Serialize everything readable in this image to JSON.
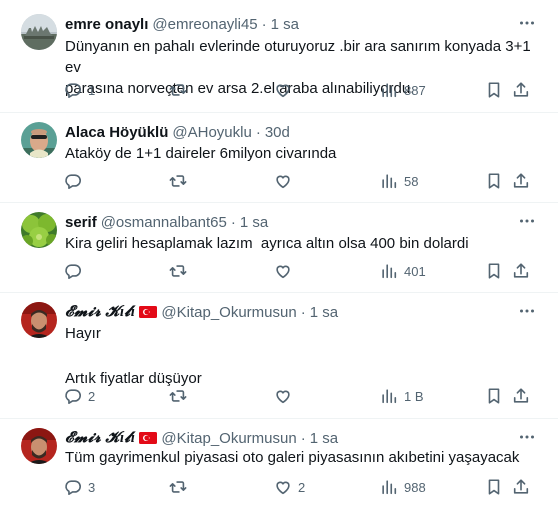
{
  "tweets": [
    {
      "name": "emre onaylı",
      "handle": "@emreonayli45",
      "time": "1 sa",
      "lines": [
        "Dünyanın en pahalı evlerinde oturuyoruz .bir ara sanırım konyada 3+1 ev",
        "parasına norveçten ev arsa 2.el araba alınabiliyordu."
      ],
      "replies": "1",
      "retweets": "",
      "likes": "",
      "views": "887"
    },
    {
      "name": "Alaca Höyüklü",
      "handle": "@AHoyuklu",
      "time": "30d",
      "lines": [
        "Ataköy de 1+1 daireler 6milyon civarında"
      ],
      "replies": "",
      "retweets": "",
      "likes": "",
      "views": "58"
    },
    {
      "name": "serif",
      "handle": "@osmannalbant65",
      "time": "1 sa",
      "lines": [
        "Kira geliri hesaplamak lazım  ayrıca altın olsa 400 bin dolardi"
      ],
      "replies": "",
      "retweets": "",
      "likes": "",
      "views": "401"
    },
    {
      "name": "𝓔𝓶𝓲𝓻 𝓚ı𝓵ı",
      "handle": "@Kitap_Okurmusun",
      "time": "1 sa",
      "lines": [
        "Hayır",
        "",
        "Artık fiyatlar düşüyor"
      ],
      "replies": "2",
      "retweets": "",
      "likes": "",
      "views": "1 B"
    },
    {
      "name": "𝓔𝓶𝓲𝓻 𝓚ı𝓵ı",
      "handle": "@Kitap_Okurmusun",
      "time": "1 sa",
      "lines": [
        "Tüm gayrimenkul piyasasi oto galeri piyasasının akıbetini yaşayacak"
      ],
      "replies": "3",
      "retweets": "",
      "likes": "2",
      "views": "988"
    }
  ],
  "separator": "·",
  "more_icon": "more-horizontal-icon",
  "colors": {
    "text": "#0f1419",
    "muted": "#536471",
    "divider": "#eff3f4"
  }
}
